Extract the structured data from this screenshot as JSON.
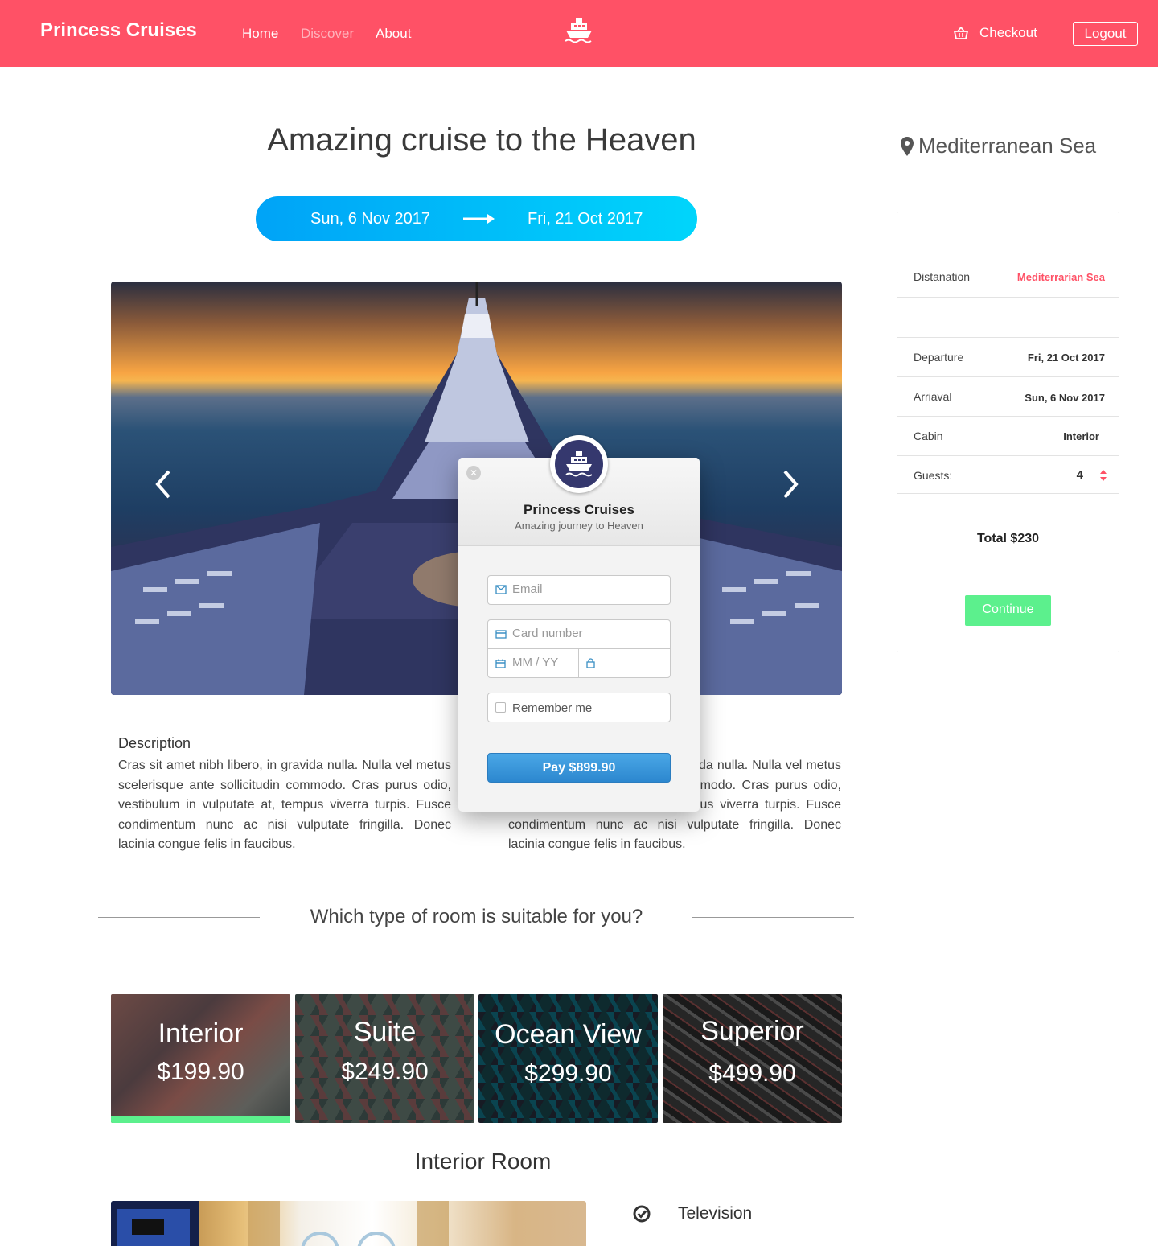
{
  "navbar": {
    "brand": "Princess Cruises",
    "links": [
      "Home",
      "Discover",
      "About"
    ],
    "checkout": "Checkout",
    "logout": "Logout",
    "icons": [
      "ship-icon",
      "basket-icon"
    ]
  },
  "hero": {
    "title": "Amazing cruise to the Heaven",
    "date_from": "Sun, 6 Nov 2017",
    "date_to": "Fri, 21 Oct 2017"
  },
  "sidebar": {
    "location": "Mediterranean Sea",
    "rows": {
      "destination_label": "Distanation",
      "destination_value": "Mediterrarian Sea",
      "departure_label": "Departure",
      "departure_value": "Fri, 21 Oct 2017",
      "arrival_label": "Arriaval",
      "arrival_value": "Sun, 6 Nov 2017",
      "cabin_label": "Cabin",
      "cabin_value": "Interior",
      "guests_label": "Guests:",
      "guests_value": "4"
    },
    "total": "Total $230",
    "continue": "Continue"
  },
  "description": {
    "heading": "Description",
    "col1": "Cras sit amet nibh libero, in gravida nulla. Nulla vel metus scelerisque ante sollicitudin commodo. Cras purus odio, vestibulum in vulputate at, tempus viverra turpis. Fusce condimentum nunc ac nisi vulputate fringilla. Donec lacinia congue felis in faucibus.",
    "col2": "Cras sit amet nibh libero, in gravida nulla. Nulla vel metus scelerisque ante sollicitudin commodo. Cras purus odio, vestibulum in vulputate at, tempus viverra turpis. Fusce condimentum nunc ac nisi vulputate fringilla. Donec lacinia congue felis in faucibus."
  },
  "rooms": {
    "question": "Which type of room is suitable for you?",
    "types": [
      {
        "name": "Interior",
        "price": "$199.90",
        "selected": true
      },
      {
        "name": "Suite",
        "price": "$249.90",
        "selected": false
      },
      {
        "name": "Ocean View",
        "price": "$299.90",
        "selected": false
      },
      {
        "name": "Superior",
        "price": "$499.90",
        "selected": false
      }
    ],
    "detail_title": "Interior Room",
    "amenities": [
      "Television"
    ]
  },
  "modal": {
    "title": "Princess Cruises",
    "subtitle": "Amazing journey to Heaven",
    "email_placeholder": "Email",
    "card_placeholder": "Card number",
    "expiry_placeholder": "MM / YY",
    "cvc_placeholder": "",
    "remember": "Remember me",
    "pay": "Pay $899.90"
  },
  "colors": {
    "brand": "#ff5166",
    "accent_green": "#5cf08d",
    "date_bar_start": "#00a3f7",
    "date_bar_end": "#00d5fb",
    "pay_blue": "#2c87cf"
  }
}
